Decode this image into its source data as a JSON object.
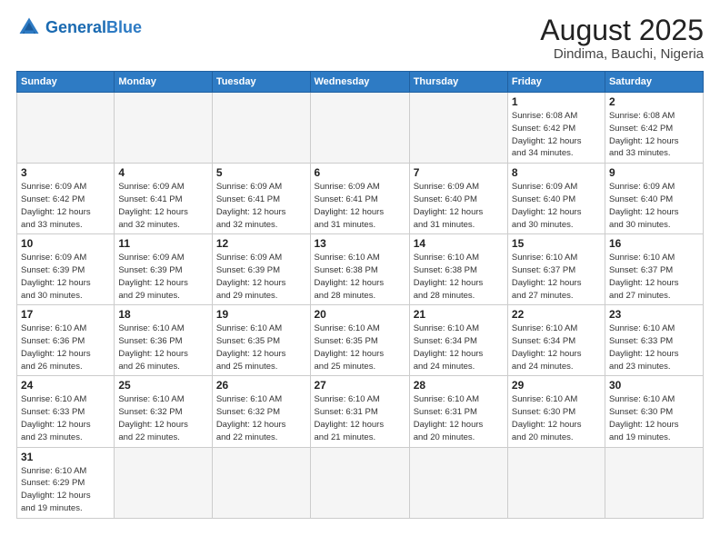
{
  "header": {
    "logo_general": "General",
    "logo_blue": "Blue",
    "title": "August 2025",
    "subtitle": "Dindima, Bauchi, Nigeria"
  },
  "weekdays": [
    "Sunday",
    "Monday",
    "Tuesday",
    "Wednesday",
    "Thursday",
    "Friday",
    "Saturday"
  ],
  "weeks": [
    [
      {
        "day": "",
        "info": ""
      },
      {
        "day": "",
        "info": ""
      },
      {
        "day": "",
        "info": ""
      },
      {
        "day": "",
        "info": ""
      },
      {
        "day": "",
        "info": ""
      },
      {
        "day": "1",
        "info": "Sunrise: 6:08 AM\nSunset: 6:42 PM\nDaylight: 12 hours\nand 34 minutes."
      },
      {
        "day": "2",
        "info": "Sunrise: 6:08 AM\nSunset: 6:42 PM\nDaylight: 12 hours\nand 33 minutes."
      }
    ],
    [
      {
        "day": "3",
        "info": "Sunrise: 6:09 AM\nSunset: 6:42 PM\nDaylight: 12 hours\nand 33 minutes."
      },
      {
        "day": "4",
        "info": "Sunrise: 6:09 AM\nSunset: 6:41 PM\nDaylight: 12 hours\nand 32 minutes."
      },
      {
        "day": "5",
        "info": "Sunrise: 6:09 AM\nSunset: 6:41 PM\nDaylight: 12 hours\nand 32 minutes."
      },
      {
        "day": "6",
        "info": "Sunrise: 6:09 AM\nSunset: 6:41 PM\nDaylight: 12 hours\nand 31 minutes."
      },
      {
        "day": "7",
        "info": "Sunrise: 6:09 AM\nSunset: 6:40 PM\nDaylight: 12 hours\nand 31 minutes."
      },
      {
        "day": "8",
        "info": "Sunrise: 6:09 AM\nSunset: 6:40 PM\nDaylight: 12 hours\nand 30 minutes."
      },
      {
        "day": "9",
        "info": "Sunrise: 6:09 AM\nSunset: 6:40 PM\nDaylight: 12 hours\nand 30 minutes."
      }
    ],
    [
      {
        "day": "10",
        "info": "Sunrise: 6:09 AM\nSunset: 6:39 PM\nDaylight: 12 hours\nand 30 minutes."
      },
      {
        "day": "11",
        "info": "Sunrise: 6:09 AM\nSunset: 6:39 PM\nDaylight: 12 hours\nand 29 minutes."
      },
      {
        "day": "12",
        "info": "Sunrise: 6:09 AM\nSunset: 6:39 PM\nDaylight: 12 hours\nand 29 minutes."
      },
      {
        "day": "13",
        "info": "Sunrise: 6:10 AM\nSunset: 6:38 PM\nDaylight: 12 hours\nand 28 minutes."
      },
      {
        "day": "14",
        "info": "Sunrise: 6:10 AM\nSunset: 6:38 PM\nDaylight: 12 hours\nand 28 minutes."
      },
      {
        "day": "15",
        "info": "Sunrise: 6:10 AM\nSunset: 6:37 PM\nDaylight: 12 hours\nand 27 minutes."
      },
      {
        "day": "16",
        "info": "Sunrise: 6:10 AM\nSunset: 6:37 PM\nDaylight: 12 hours\nand 27 minutes."
      }
    ],
    [
      {
        "day": "17",
        "info": "Sunrise: 6:10 AM\nSunset: 6:36 PM\nDaylight: 12 hours\nand 26 minutes."
      },
      {
        "day": "18",
        "info": "Sunrise: 6:10 AM\nSunset: 6:36 PM\nDaylight: 12 hours\nand 26 minutes."
      },
      {
        "day": "19",
        "info": "Sunrise: 6:10 AM\nSunset: 6:35 PM\nDaylight: 12 hours\nand 25 minutes."
      },
      {
        "day": "20",
        "info": "Sunrise: 6:10 AM\nSunset: 6:35 PM\nDaylight: 12 hours\nand 25 minutes."
      },
      {
        "day": "21",
        "info": "Sunrise: 6:10 AM\nSunset: 6:34 PM\nDaylight: 12 hours\nand 24 minutes."
      },
      {
        "day": "22",
        "info": "Sunrise: 6:10 AM\nSunset: 6:34 PM\nDaylight: 12 hours\nand 24 minutes."
      },
      {
        "day": "23",
        "info": "Sunrise: 6:10 AM\nSunset: 6:33 PM\nDaylight: 12 hours\nand 23 minutes."
      }
    ],
    [
      {
        "day": "24",
        "info": "Sunrise: 6:10 AM\nSunset: 6:33 PM\nDaylight: 12 hours\nand 23 minutes."
      },
      {
        "day": "25",
        "info": "Sunrise: 6:10 AM\nSunset: 6:32 PM\nDaylight: 12 hours\nand 22 minutes."
      },
      {
        "day": "26",
        "info": "Sunrise: 6:10 AM\nSunset: 6:32 PM\nDaylight: 12 hours\nand 22 minutes."
      },
      {
        "day": "27",
        "info": "Sunrise: 6:10 AM\nSunset: 6:31 PM\nDaylight: 12 hours\nand 21 minutes."
      },
      {
        "day": "28",
        "info": "Sunrise: 6:10 AM\nSunset: 6:31 PM\nDaylight: 12 hours\nand 20 minutes."
      },
      {
        "day": "29",
        "info": "Sunrise: 6:10 AM\nSunset: 6:30 PM\nDaylight: 12 hours\nand 20 minutes."
      },
      {
        "day": "30",
        "info": "Sunrise: 6:10 AM\nSunset: 6:30 PM\nDaylight: 12 hours\nand 19 minutes."
      }
    ],
    [
      {
        "day": "31",
        "info": "Sunrise: 6:10 AM\nSunset: 6:29 PM\nDaylight: 12 hours\nand 19 minutes."
      },
      {
        "day": "",
        "info": ""
      },
      {
        "day": "",
        "info": ""
      },
      {
        "day": "",
        "info": ""
      },
      {
        "day": "",
        "info": ""
      },
      {
        "day": "",
        "info": ""
      },
      {
        "day": "",
        "info": ""
      }
    ]
  ]
}
